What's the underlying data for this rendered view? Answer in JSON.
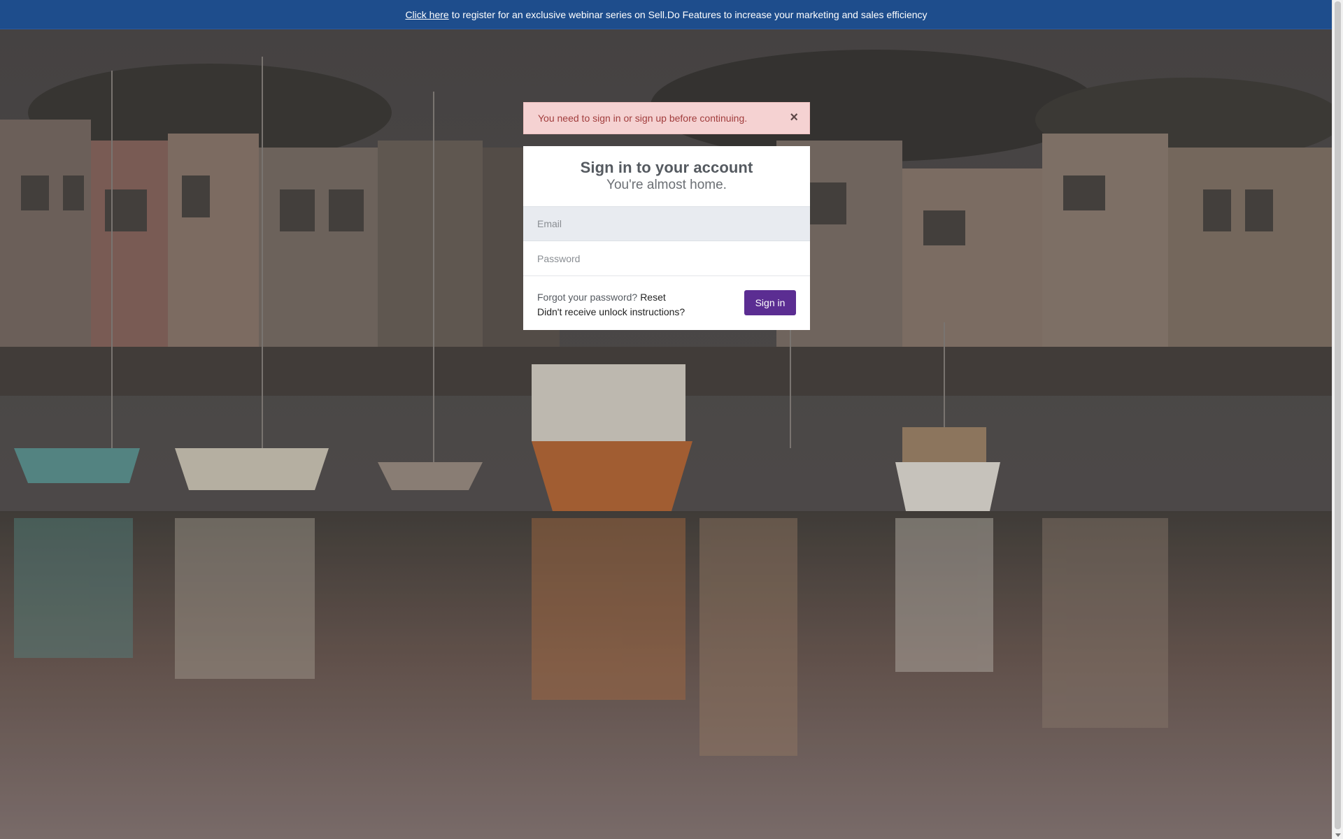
{
  "banner": {
    "link_text": "Click here",
    "message": "to register for an exclusive webinar series on Sell.Do Features to increase your marketing and sales efficiency",
    "color": "#1e4d8c"
  },
  "alert": {
    "message": "You need to sign in or sign up before continuing.",
    "close_glyph": "×",
    "color": "#f5d2d2"
  },
  "login": {
    "title": "Sign in to your account",
    "subtitle": "You're almost home.",
    "email_placeholder": "Email",
    "password_placeholder": "Password",
    "forgot_text": "Forgot your password?",
    "reset_link": "Reset",
    "unlock_link": "Didn't receive unlock instructions?",
    "signin_button": "Sign in",
    "button_color": "#5b2d92"
  }
}
